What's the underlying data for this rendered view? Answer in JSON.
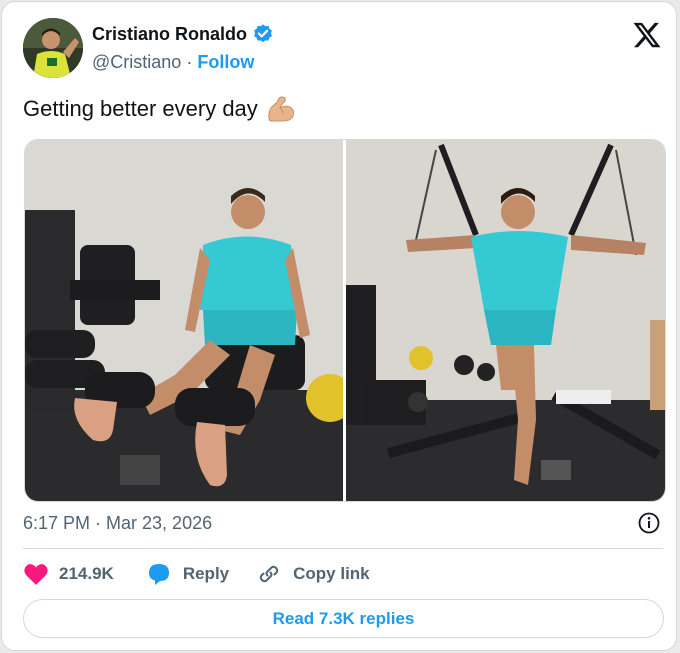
{
  "author": {
    "name": "Cristiano Ronaldo",
    "handle": "@Cristiano",
    "separator": "·",
    "follow_label": "Follow"
  },
  "tweet": {
    "text": "Getting better every day",
    "emoji": "flexed-biceps-icon"
  },
  "meta": {
    "timestamp": "6:17 PM · Mar 23, 2026"
  },
  "actions": {
    "like_count": "214.9K",
    "reply_label": "Reply",
    "copy_label": "Copy link"
  },
  "read_replies_label": "Read 7.3K replies",
  "colors": {
    "accent": "#1d9bf0",
    "like": "#f91880",
    "muted": "#536471",
    "text": "#0f1419",
    "shirt": "#35c9d4"
  }
}
